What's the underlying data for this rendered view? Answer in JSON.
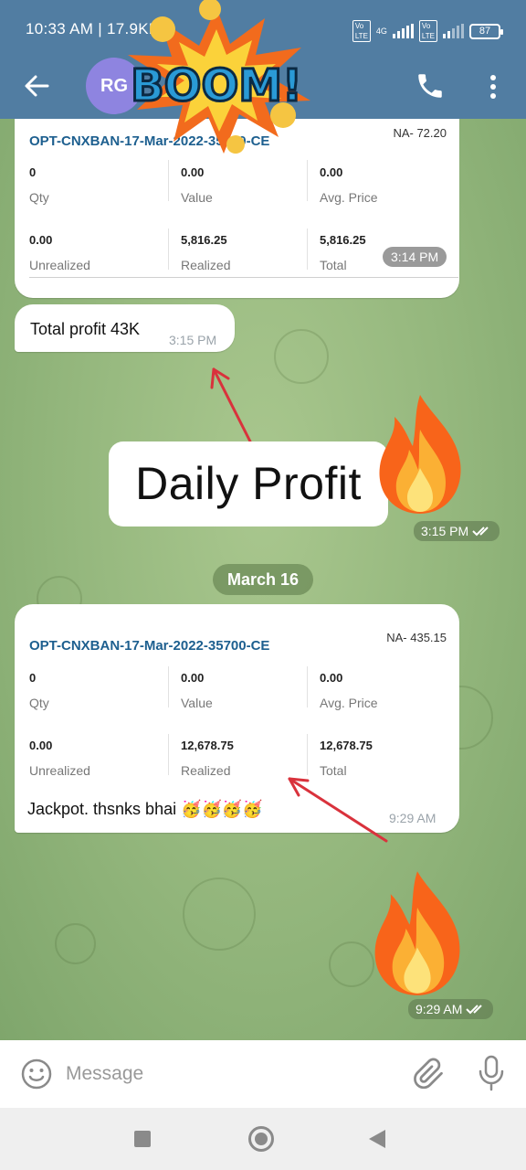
{
  "status_bar": {
    "time": "10:33 AM | 17.9KB/s",
    "network": "4G",
    "battery": "87"
  },
  "header": {
    "avatar_initials": "RG"
  },
  "sticker_text": "BOOM!",
  "messages": [
    {
      "card": {
        "title": "OPT-CNXBAN-17-Mar-2022-35500-CE",
        "na": "NA- 72.20",
        "row1": [
          {
            "value": "0",
            "label": "Qty"
          },
          {
            "value": "0.00",
            "label": "Value"
          },
          {
            "value": "0.00",
            "label": "Avg. Price"
          }
        ],
        "row2": [
          {
            "value": "0.00",
            "label": "Unrealized"
          },
          {
            "value": "5,816.25",
            "label": "Realized"
          },
          {
            "value": "5,816.25",
            "label": "Total"
          }
        ]
      },
      "time": "3:14 PM"
    },
    {
      "text": "Total profit 43K",
      "time": "3:15 PM"
    },
    {
      "overlay_text": "Daily Profit",
      "time": "3:15 PM"
    },
    {
      "card": {
        "title": "OPT-CNXBAN-17-Mar-2022-35700-CE",
        "na": "NA- 435.15",
        "row1": [
          {
            "value": "0",
            "label": "Qty"
          },
          {
            "value": "0.00",
            "label": "Value"
          },
          {
            "value": "0.00",
            "label": "Avg. Price"
          }
        ],
        "row2": [
          {
            "value": "0.00",
            "label": "Unrealized"
          },
          {
            "value": "12,678.75",
            "label": "Realized"
          },
          {
            "value": "12,678.75",
            "label": "Total"
          }
        ]
      },
      "text": "Jackpot. thsnks bhai 🥳🥳🥳🥳",
      "time": "9:29 AM"
    },
    {
      "time": "9:29 AM"
    }
  ],
  "date_separator": "March 16",
  "input": {
    "placeholder": "Message"
  },
  "colors": {
    "header": "#517da2",
    "card_title": "#1d5f8f",
    "arrow": "#d9323c"
  }
}
